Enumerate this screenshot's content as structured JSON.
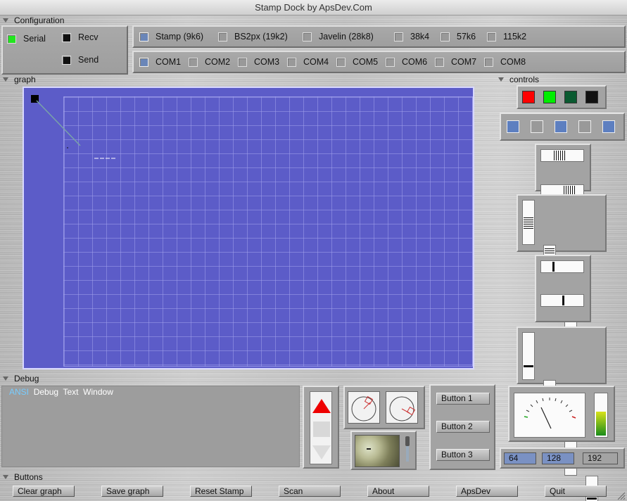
{
  "window": {
    "title": "Stamp Dock by ApsDev.Com"
  },
  "configuration": {
    "label": "Configuration",
    "serial_label": "Serial",
    "recv_label": "Recv",
    "send_label": "Send",
    "speeds": [
      "Stamp (9k6)",
      "BS2px (19k2)",
      "Javelin (28k8)",
      "38k4",
      "57k6",
      "115k2"
    ],
    "ports": [
      "COM1",
      "COM2",
      "COM3",
      "COM4",
      "COM5",
      "COM6",
      "COM7",
      "COM8"
    ]
  },
  "graph": {
    "label": "graph"
  },
  "controls": {
    "label": "controls",
    "color_swatches": [
      "#ff0000",
      "#00ee00",
      "#0a5a30",
      "#111111"
    ],
    "toggle_squares": [
      "#5d7fc0",
      "#999999",
      "#5d7fc0",
      "#999999",
      "#5d7fc0"
    ]
  },
  "debug": {
    "label": "Debug",
    "title_prefix": "ANSI",
    "title_rest": "Debug  Text  Window"
  },
  "side_buttons": [
    "Button 1",
    "Button 2",
    "Button 3"
  ],
  "meter": {
    "values": [
      "64",
      "128",
      "192"
    ]
  },
  "buttons_section": {
    "label": "Buttons",
    "items": [
      "Clear graph",
      "Save graph",
      "Reset Stamp",
      "Scan",
      "About",
      "ApsDev",
      "Quit"
    ]
  }
}
